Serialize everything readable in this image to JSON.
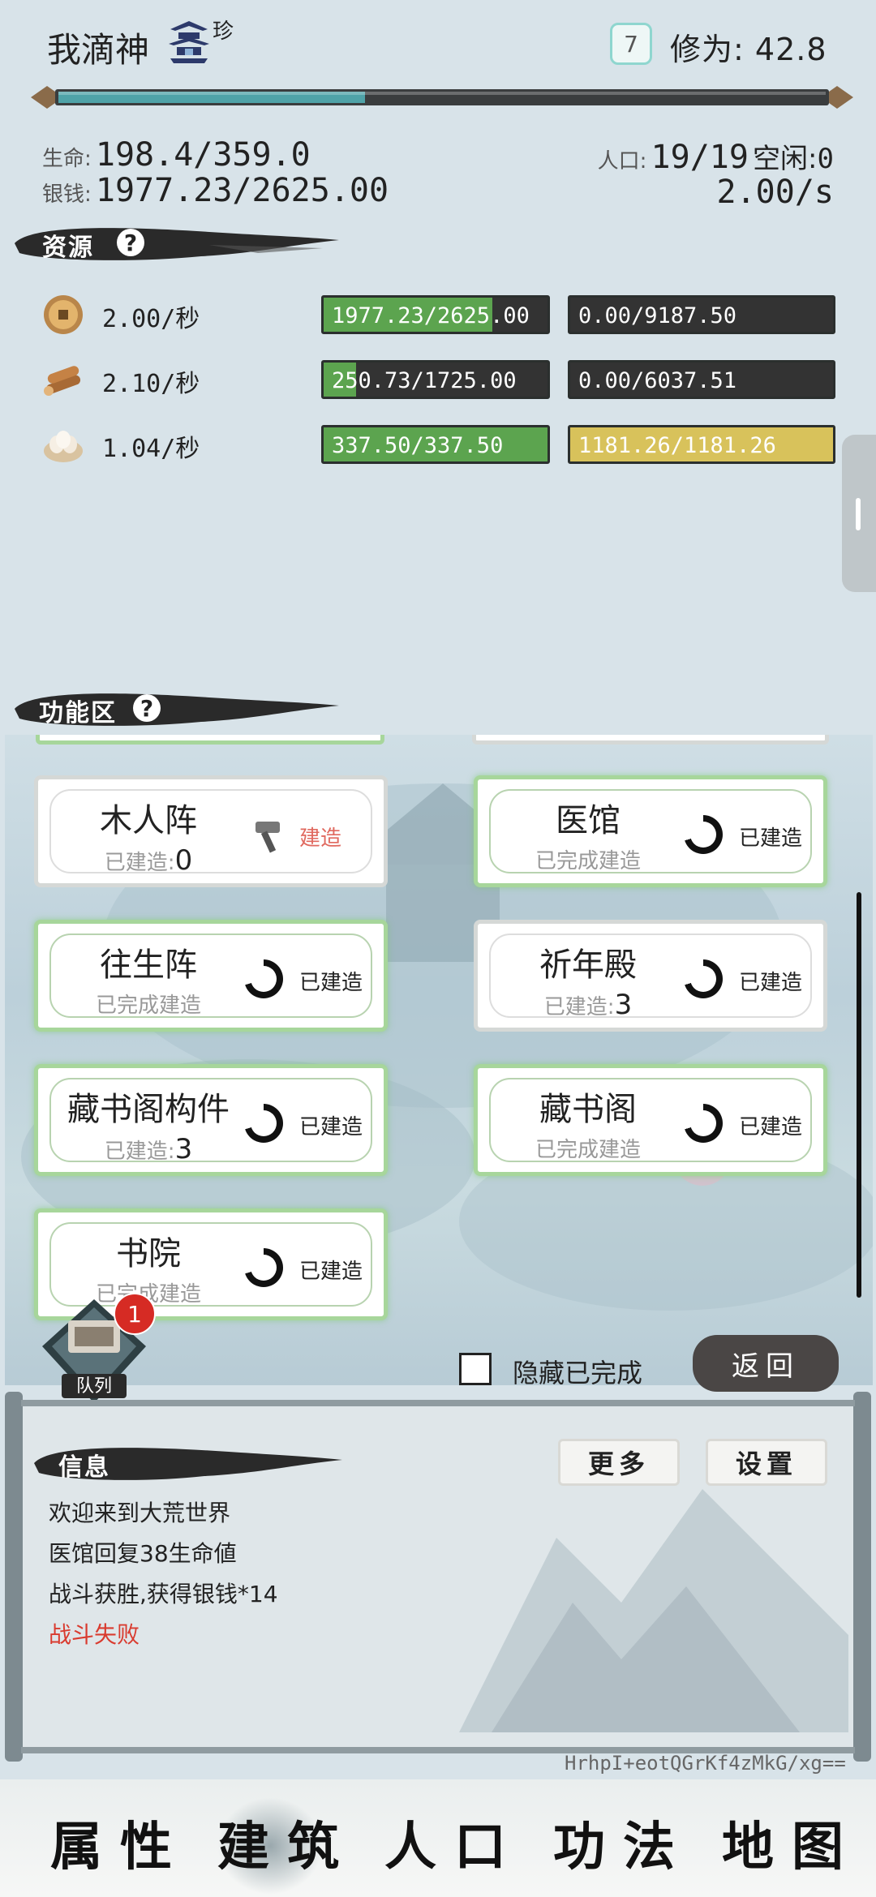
{
  "header": {
    "player_name": "我滴神",
    "rank_icon": "pagoda-icon",
    "rank_label": "珍",
    "level": "7",
    "cultivation_label": "修为:",
    "cultivation_value": "42.8",
    "xp_progress": 0.4
  },
  "stats": {
    "life_label": "生命:",
    "life_value": "198.4/359.0",
    "silver_label": "银钱:",
    "silver_value": "1977.23/2625.00",
    "population_label": "人口:",
    "population_value": "19/19",
    "idle_label": "空闲:",
    "idle_value": "0",
    "income_rate": "2.00/s"
  },
  "resources": {
    "title": "资源",
    "help": "?",
    "items": [
      {
        "icon": "coin-icon",
        "rate": "2.00/秒",
        "primary": "1977.23/2625.00",
        "primary_fill": 0.753,
        "secondary": "0.00/9187.50",
        "secondary_fill": 0.0,
        "secondary_color": "#333333"
      },
      {
        "icon": "wood-icon",
        "rate": "2.10/秒",
        "primary": "250.73/1725.00",
        "primary_fill": 0.145,
        "secondary": "0.00/6037.51",
        "secondary_fill": 0.0,
        "secondary_color": "#333333"
      },
      {
        "icon": "egg-icon",
        "rate": "1.04/秒",
        "primary": "337.50/337.50",
        "primary_fill": 1.0,
        "secondary": "1181.26/1181.26",
        "secondary_fill": 1.0,
        "secondary_color": "#d8c25b"
      }
    ]
  },
  "function_area": {
    "title": "功能区",
    "help": "?",
    "cards": [
      {
        "name": "木人阵",
        "status_prefix": "已建造:",
        "count": "0",
        "action": "建造",
        "state": "pending"
      },
      {
        "name": "医馆",
        "status_prefix": "已完成建造",
        "count": "",
        "action": "已建造",
        "state": "done"
      },
      {
        "name": "往生阵",
        "status_prefix": "已完成建造",
        "count": "",
        "action": "已建造",
        "state": "done"
      },
      {
        "name": "祈年殿",
        "status_prefix": "已建造:",
        "count": "3",
        "action": "已建造",
        "state": "pending"
      },
      {
        "name": "藏书阁构件",
        "status_prefix": "已建造:",
        "count": "3",
        "action": "已建造",
        "state": "done"
      },
      {
        "name": "藏书阁",
        "status_prefix": "已完成建造",
        "count": "",
        "action": "已建造",
        "state": "done"
      },
      {
        "name": "书院",
        "status_prefix": "已完成建造",
        "count": "",
        "action": "已建造",
        "state": "done"
      }
    ],
    "queue_label": "队列",
    "queue_count": "1",
    "hide_completed_label": "隐藏已完成",
    "back_label": "返回"
  },
  "messages": {
    "title": "信息",
    "more_label": "更多",
    "settings_label": "设置",
    "lines": [
      "欢迎来到大荒世界",
      "医馆回复38生命値",
      "战斗获胜,获得银钱*14",
      "战斗失败"
    ],
    "alert_color": "#d93b2f",
    "code": "HrhpI+eotQGrKf4zMkG/xg=="
  },
  "nav": [
    "属性",
    "建筑",
    "人口",
    "功法",
    "地图"
  ],
  "colors": {
    "bar_green": "#5ca44f",
    "bar_dark": "#333333",
    "xp_teal": "#4fa3a8",
    "alert_red": "#d62b24"
  }
}
